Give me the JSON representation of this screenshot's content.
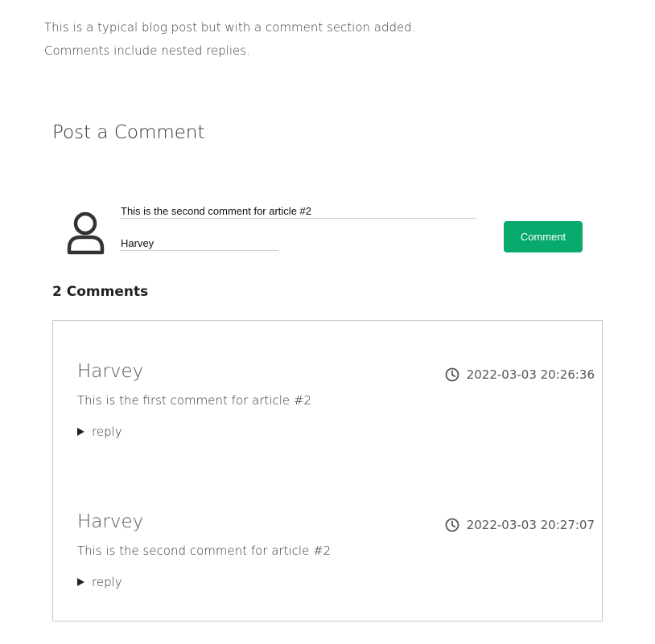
{
  "intro": {
    "line1": "This is a typical blog post but with a comment section added.",
    "line2": "Comments include nested replies."
  },
  "comment_form": {
    "title": "Post a Comment",
    "avatar_icon": "user-avatar-icon",
    "comment_value": "This is the second comment for article #2",
    "name_value": "Harvey",
    "submit_label": "Comment",
    "submit_color": "#07a96c"
  },
  "comments_section": {
    "count_label": "2 Comments",
    "comments": [
      {
        "author": "Harvey",
        "timestamp": "2022-03-03 20:26:36",
        "text": "This is the first comment for article #2",
        "reply_label": "reply"
      },
      {
        "author": "Harvey",
        "timestamp": "2022-03-03 20:27:07",
        "text": "This is the second comment for article #2",
        "reply_label": "reply"
      }
    ]
  }
}
